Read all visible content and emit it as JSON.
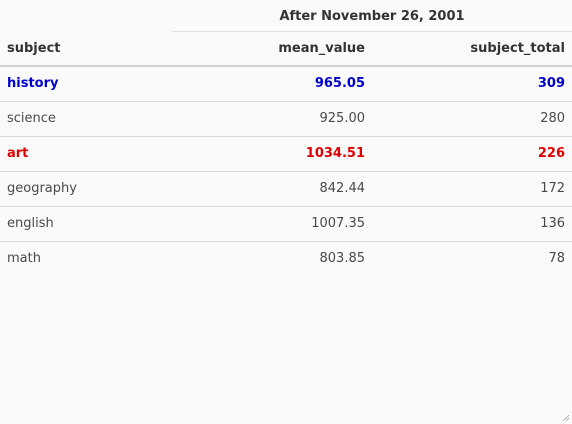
{
  "table": {
    "spanner_label": "After November 26, 2001",
    "columns": [
      "subject",
      "mean_value",
      "subject_total"
    ],
    "rows": [
      {
        "subject": "history",
        "mean_value": "965.05",
        "subject_total": "309",
        "highlight_color": "#0000cc"
      },
      {
        "subject": "science",
        "mean_value": "925.00",
        "subject_total": "280",
        "highlight_color": null
      },
      {
        "subject": "art",
        "mean_value": "1034.51",
        "subject_total": "226",
        "highlight_color": "#e00000"
      },
      {
        "subject": "geography",
        "mean_value": "842.44",
        "subject_total": "172",
        "highlight_color": null
      },
      {
        "subject": "english",
        "mean_value": "1007.35",
        "subject_total": "136",
        "highlight_color": null
      },
      {
        "subject": "math",
        "mean_value": "803.85",
        "subject_total": "78",
        "highlight_color": null
      }
    ]
  },
  "colors": {
    "background": "#fafafa",
    "text": "#4a4a4a",
    "history_highlight": "#0000cc",
    "art_highlight": "#e00000"
  },
  "icons": {
    "resize_grip": "resize-grip-icon"
  }
}
